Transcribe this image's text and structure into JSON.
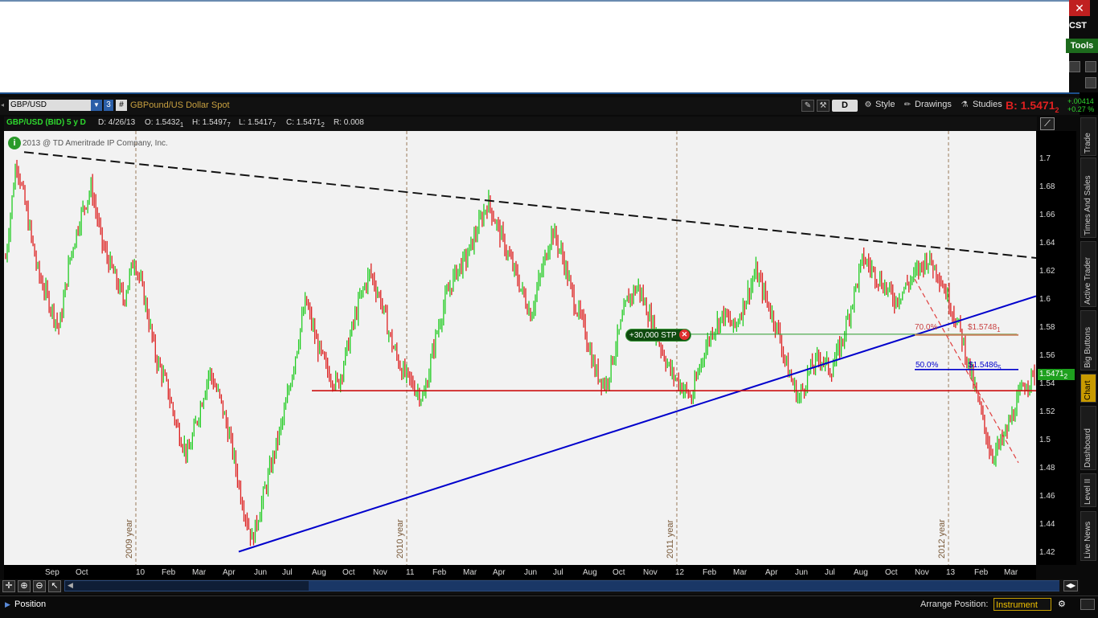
{
  "window": {
    "close_glyph": "✕",
    "timezone": "CST",
    "tools_label": "Tools"
  },
  "chart_header": {
    "symbol": "GBP/USD",
    "link_number": "3",
    "hash": "#",
    "description": "GBPound/US Dollar Spot",
    "period_label": "D",
    "style_label": "Style",
    "drawings_label": "Drawings",
    "studies_label": "Studies",
    "bid_label": "B: 1.5471",
    "bid_sub": "2",
    "change_abs": "+.00414",
    "change_pct": "+0.27 %"
  },
  "info_bar": {
    "symbol": "GBP/USD (BID) 5 y D",
    "date": "D: 4/26/13",
    "open": "O: 1.5432",
    "open_sub": "1",
    "high": "H: 1.5497",
    "high_sub": "7",
    "low": "L: 1.5417",
    "low_sub": "7",
    "close": "C: 1.5471",
    "close_sub": "2",
    "range": "R: 0.008"
  },
  "copyright": "2013 @ TD Ameritrade IP Company, Inc.",
  "price_tag": "1.5471",
  "price_tag_sub": "2",
  "order_tag": "+30,000 STP",
  "order_close_glyph": "✕",
  "fib": {
    "level70": "70.0%",
    "price70": "$1.5748",
    "price70_sub": "1",
    "level50": "50.0%",
    "price50": "$1.5486",
    "price50_sub": "5"
  },
  "year_labels": [
    "2009 year",
    "2010 year",
    "2011 year",
    "2012 year"
  ],
  "bottom": {
    "position_label": "Position",
    "arrange_label": "Arrange Position:",
    "arrange_value": "Instrument"
  },
  "side_tabs": [
    "Trade",
    "Times And Sales",
    "Active Trader",
    "Big Buttons",
    "Chart",
    "Dashboard",
    "Level II",
    "Live News"
  ],
  "colors": {
    "up_bar": "#22cc22",
    "down_bar": "#dd2020",
    "trend_blue": "#0000cc",
    "support_red": "#cc1010",
    "fib_green": "#2a9a2a",
    "fib_70": "#c8805a",
    "fib_50": "#0000cc",
    "active_tab": "#c89a00"
  },
  "chart_data": {
    "type": "candlestick",
    "y_ticks": [
      "1.7",
      "1.68",
      "1.66",
      "1.64",
      "1.62",
      "1.6",
      "1.58",
      "1.56",
      "1.54",
      "1.52",
      "1.5",
      "1.48",
      "1.46",
      "1.44",
      "1.42"
    ],
    "ylim": [
      1.41,
      1.72
    ],
    "x_ticks": [
      "Sep",
      "Oct",
      "10",
      "Feb",
      "Mar",
      "Apr",
      "Jun",
      "Jul",
      "Aug",
      "Oct",
      "Nov",
      "11",
      "Feb",
      "Mar",
      "Apr",
      "Jun",
      "Jul",
      "Aug",
      "Oct",
      "Nov",
      "12",
      "Feb",
      "Mar",
      "Apr",
      "Jun",
      "Jul",
      "Aug",
      "Oct",
      "Nov",
      "13",
      "Feb",
      "Mar"
    ],
    "price_path": [
      1.63,
      1.7,
      1.66,
      1.62,
      1.6,
      1.58,
      1.63,
      1.66,
      1.68,
      1.64,
      1.62,
      1.6,
      1.63,
      1.6,
      1.56,
      1.54,
      1.51,
      1.49,
      1.52,
      1.55,
      1.53,
      1.5,
      1.46,
      1.43,
      1.46,
      1.49,
      1.52,
      1.56,
      1.6,
      1.57,
      1.55,
      1.54,
      1.57,
      1.6,
      1.62,
      1.6,
      1.57,
      1.55,
      1.54,
      1.53,
      1.57,
      1.6,
      1.62,
      1.63,
      1.65,
      1.67,
      1.65,
      1.63,
      1.61,
      1.59,
      1.62,
      1.65,
      1.63,
      1.6,
      1.58,
      1.55,
      1.54,
      1.57,
      1.6,
      1.61,
      1.59,
      1.57,
      1.55,
      1.54,
      1.53,
      1.56,
      1.58,
      1.59,
      1.58,
      1.6,
      1.62,
      1.6,
      1.58,
      1.55,
      1.53,
      1.55,
      1.56,
      1.55,
      1.57,
      1.6,
      1.63,
      1.62,
      1.61,
      1.6,
      1.61,
      1.62,
      1.63,
      1.62,
      1.6,
      1.58,
      1.55,
      1.52,
      1.49,
      1.5,
      1.52,
      1.54,
      1.5471
    ]
  }
}
